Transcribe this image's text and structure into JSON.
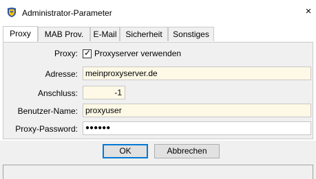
{
  "window": {
    "title": "Administrator-Parameter",
    "close_glyph": "×"
  },
  "tabs": [
    {
      "label": "Proxy",
      "active": true
    },
    {
      "label": "MAB Prov.",
      "active": false
    },
    {
      "label": "E-Mail",
      "active": false
    },
    {
      "label": "Sicherheit",
      "active": false
    },
    {
      "label": "Sonstiges",
      "active": false
    }
  ],
  "form": {
    "proxy_label": "Proxy:",
    "proxy_checkbox_label": "Proxyserver verwenden",
    "proxy_checkbox_checked": true,
    "check_glyph": "✓",
    "address_label": "Adresse:",
    "address_value": "meinproxyserver.de",
    "port_label": "Anschluss:",
    "port_value": "-1",
    "username_label": "Benutzer-Name:",
    "username_value": "proxyuser",
    "password_label": "Proxy-Password:",
    "password_value": "●●●●●●"
  },
  "buttons": {
    "ok": "OK",
    "cancel": "Abbrechen"
  },
  "status": {
    "text": ""
  },
  "colors": {
    "input_yellow": "#fdf9e6",
    "panel_bg": "#f0f0f0",
    "default_button_border": "#0078d7"
  },
  "icons": {
    "app": "shield-icon",
    "close": "close-icon"
  }
}
